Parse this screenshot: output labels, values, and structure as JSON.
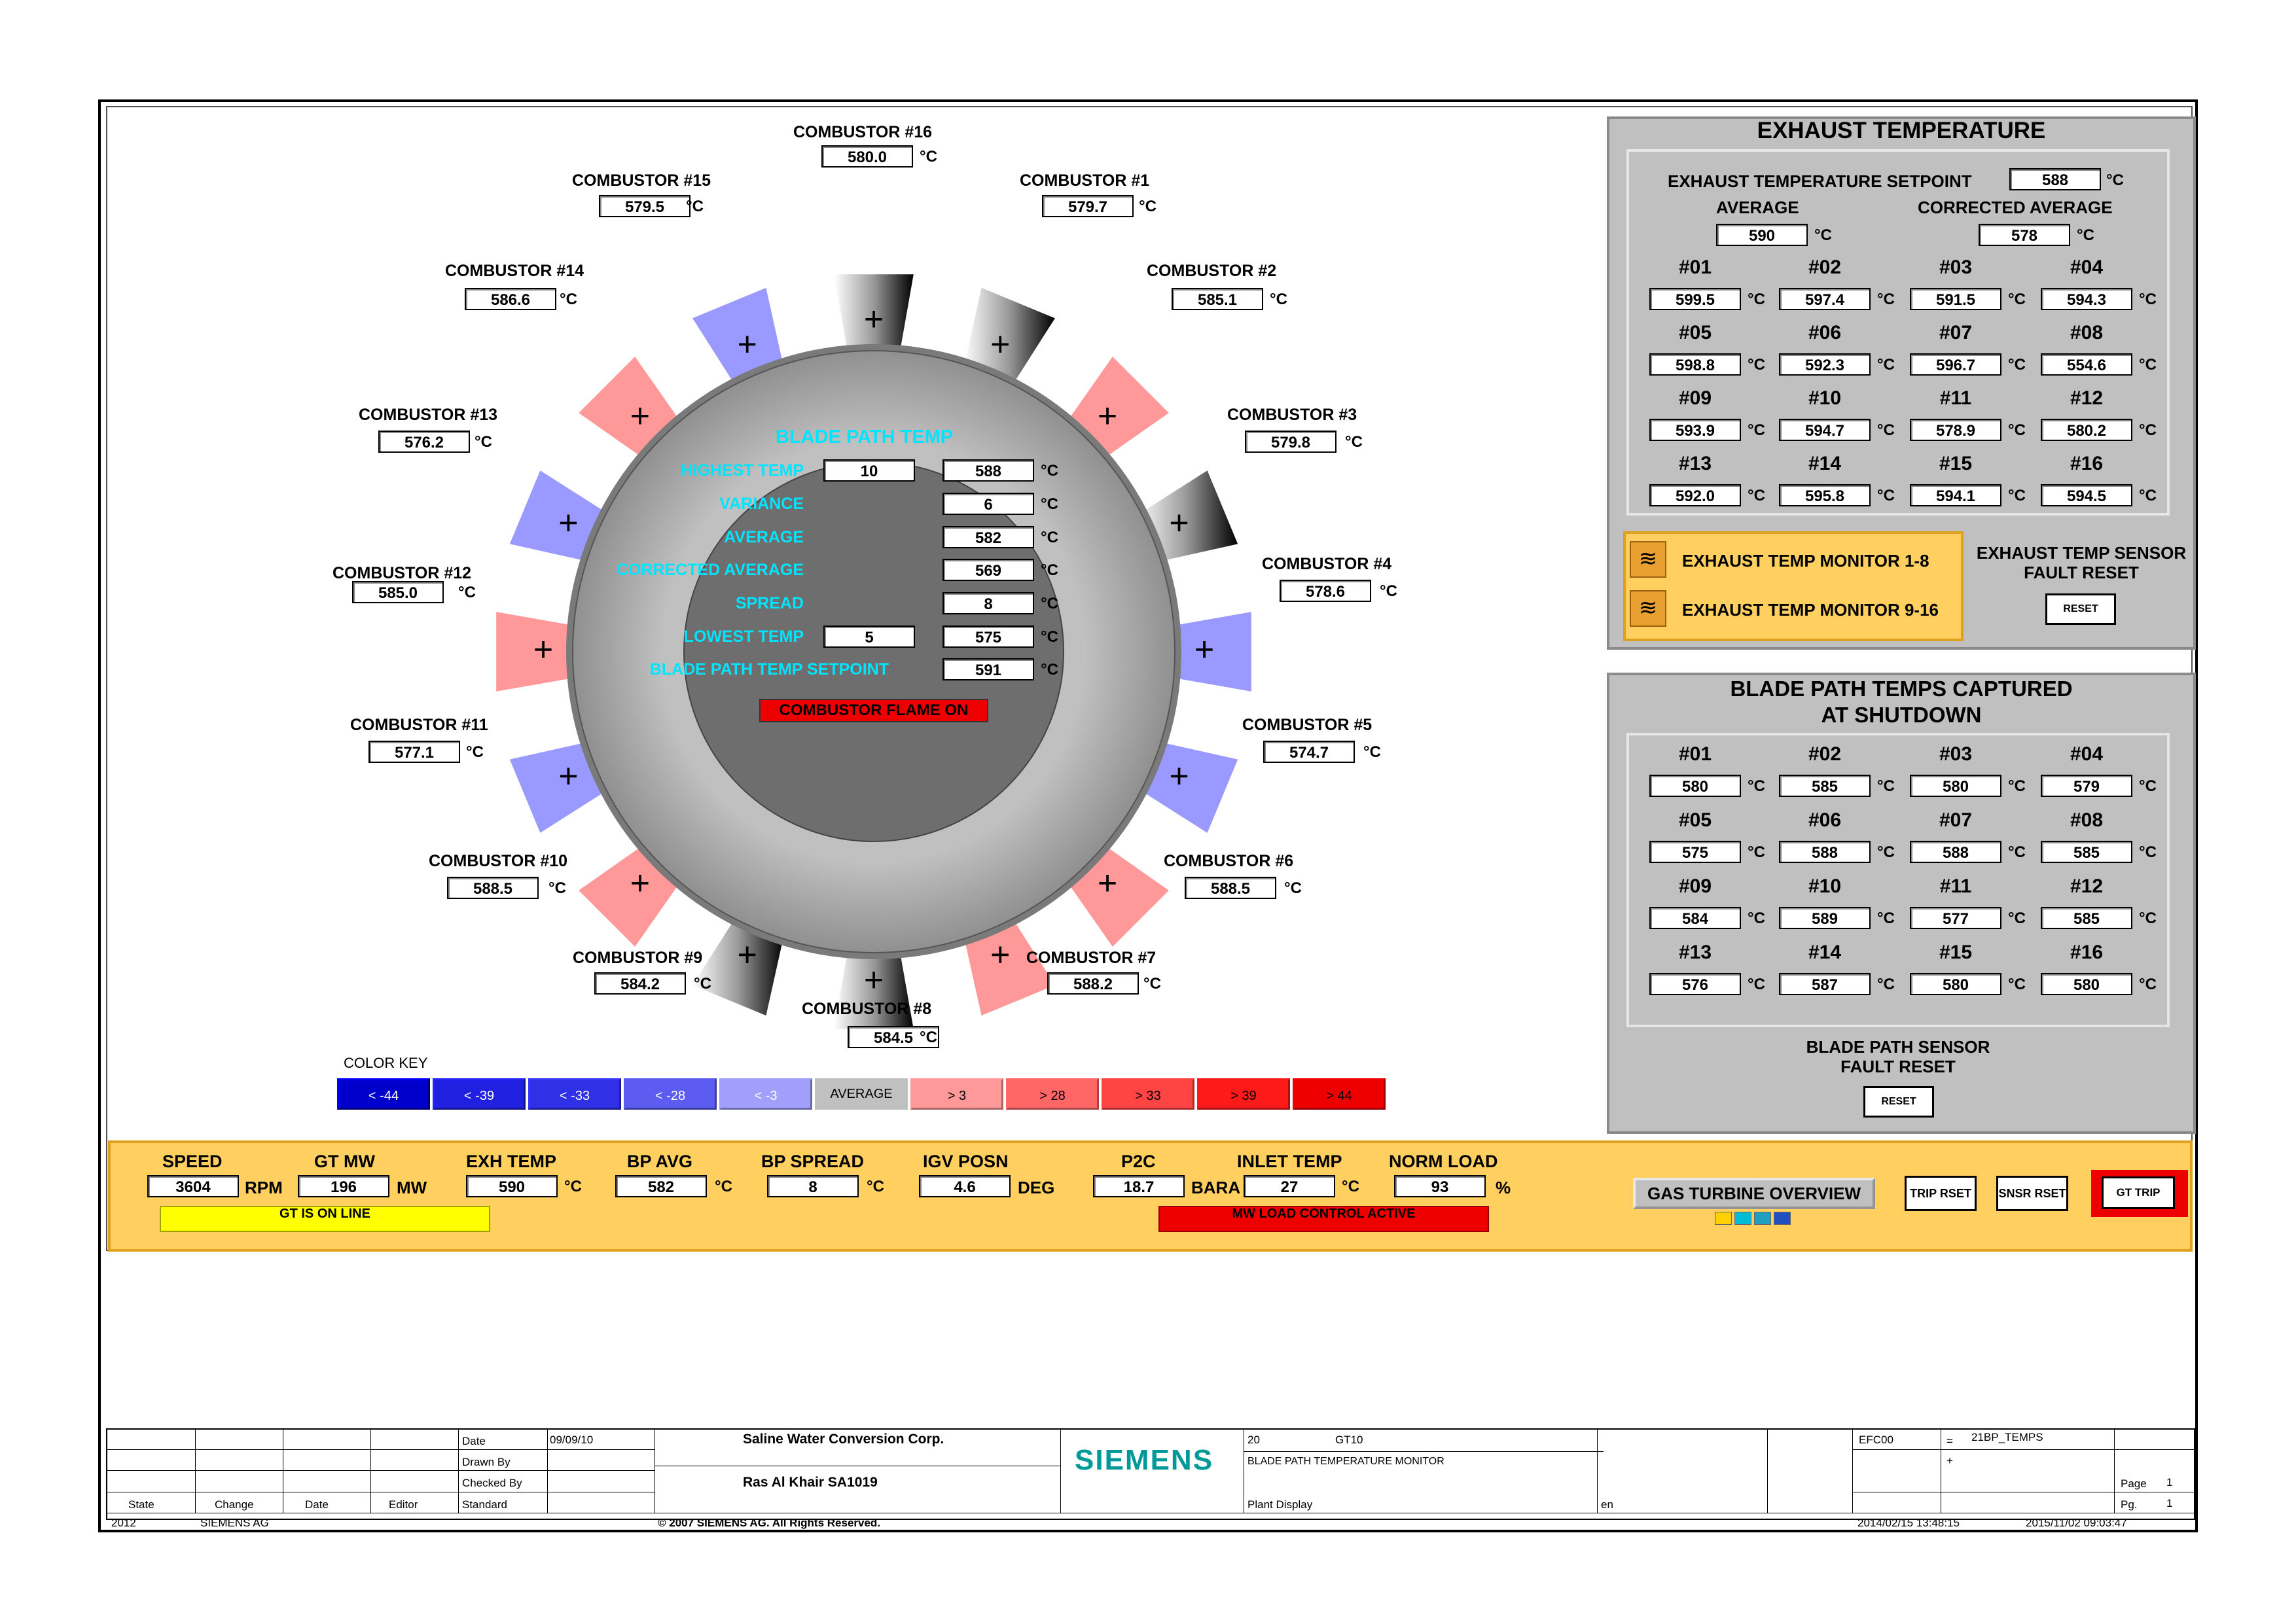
{
  "combustors": [
    {
      "id": "#16",
      "label": "COMBUSTOR #16",
      "value": "580.0"
    },
    {
      "id": "#1",
      "label": "COMBUSTOR #1",
      "value": "579.7"
    },
    {
      "id": "#2",
      "label": "COMBUSTOR #2",
      "value": "585.1"
    },
    {
      "id": "#3",
      "label": "COMBUSTOR #3",
      "value": "579.8"
    },
    {
      "id": "#4",
      "label": "COMBUSTOR #4",
      "value": "578.6"
    },
    {
      "id": "#5",
      "label": "COMBUSTOR #5",
      "value": "574.7"
    },
    {
      "id": "#6",
      "label": "COMBUSTOR #6",
      "value": "588.5"
    },
    {
      "id": "#7",
      "label": "COMBUSTOR #7",
      "value": "588.2"
    },
    {
      "id": "#8",
      "label": "COMBUSTOR #8",
      "value": "584.5"
    },
    {
      "id": "#9",
      "label": "COMBUSTOR #9",
      "value": "584.2"
    },
    {
      "id": "#10",
      "label": "COMBUSTOR #10",
      "value": "588.5"
    },
    {
      "id": "#11",
      "label": "COMBUSTOR #11",
      "value": "577.1"
    },
    {
      "id": "#12",
      "label": "COMBUSTOR #12",
      "value": "585.0"
    },
    {
      "id": "#13",
      "label": "COMBUSTOR #13",
      "value": "576.2"
    },
    {
      "id": "#14",
      "label": "COMBUSTOR #14",
      "value": "586.6"
    },
    {
      "id": "#15",
      "label": "COMBUSTOR #15",
      "value": "579.5"
    }
  ],
  "unit_c": "°C",
  "blade_path": {
    "title": "BLADE PATH TEMP",
    "highest_label": "HIGHEST TEMP",
    "highest_idx": "10",
    "highest_val": "588",
    "variance_label": "VARIANCE",
    "variance_val": "6",
    "average_label": "AVERAGE",
    "average_val": "582",
    "corrected_label": "CORRECTED AVERAGE",
    "corrected_val": "569",
    "spread_label": "SPREAD",
    "spread_val": "8",
    "lowest_label": "LOWEST TEMP",
    "lowest_idx": "5",
    "lowest_val": "575",
    "setpoint_label": "BLADE PATH TEMP SETPOINT",
    "setpoint_val": "591",
    "flame_status": "COMBUSTOR FLAME ON"
  },
  "color_key": {
    "label": "COLOR KEY",
    "items": [
      "< -44",
      "< -39",
      "< -33",
      "< -28",
      "< -3",
      "AVERAGE",
      "> 3",
      "> 28",
      "> 33",
      "> 39",
      "> 44"
    ],
    "colors": [
      "#0000cc",
      "#2020e0",
      "#3030e6",
      "#5c5cf0",
      "#a0a0fa",
      "#c0c0c0",
      "#ff9999",
      "#ff6666",
      "#ff4444",
      "#ff1a1a",
      "#ee0000"
    ]
  },
  "exhaust": {
    "title": "EXHAUST TEMPERATURE",
    "setpoint_label": "EXHAUST TEMPERATURE SETPOINT",
    "setpoint_val": "588",
    "avg_label": "AVERAGE",
    "avg_val": "590",
    "corr_label": "CORRECTED AVERAGE",
    "corr_val": "578",
    "cells": [
      {
        "n": "#01",
        "v": "599.5"
      },
      {
        "n": "#02",
        "v": "597.4"
      },
      {
        "n": "#03",
        "v": "591.5"
      },
      {
        "n": "#04",
        "v": "594.3"
      },
      {
        "n": "#05",
        "v": "598.8"
      },
      {
        "n": "#06",
        "v": "592.3"
      },
      {
        "n": "#07",
        "v": "596.7"
      },
      {
        "n": "#08",
        "v": "554.6"
      },
      {
        "n": "#09",
        "v": "593.9"
      },
      {
        "n": "#10",
        "v": "594.7"
      },
      {
        "n": "#11",
        "v": "578.9"
      },
      {
        "n": "#12",
        "v": "580.2"
      },
      {
        "n": "#13",
        "v": "592.0"
      },
      {
        "n": "#14",
        "v": "595.8"
      },
      {
        "n": "#15",
        "v": "594.1"
      },
      {
        "n": "#16",
        "v": "594.5"
      }
    ],
    "monitor1": "EXHAUST TEMP MONITOR 1-8",
    "monitor2": "EXHAUST TEMP MONITOR 9-16",
    "fault_line1": "EXHAUST TEMP SENSOR",
    "fault_line2": "FAULT RESET",
    "reset": "RESET"
  },
  "captured": {
    "title1": "BLADE PATH TEMPS CAPTURED",
    "title2": "AT SHUTDOWN",
    "cells": [
      {
        "n": "#01",
        "v": "580"
      },
      {
        "n": "#02",
        "v": "585"
      },
      {
        "n": "#03",
        "v": "580"
      },
      {
        "n": "#04",
        "v": "579"
      },
      {
        "n": "#05",
        "v": "575"
      },
      {
        "n": "#06",
        "v": "588"
      },
      {
        "n": "#07",
        "v": "588"
      },
      {
        "n": "#08",
        "v": "585"
      },
      {
        "n": "#09",
        "v": "584"
      },
      {
        "n": "#10",
        "v": "589"
      },
      {
        "n": "#11",
        "v": "577"
      },
      {
        "n": "#12",
        "v": "585"
      },
      {
        "n": "#13",
        "v": "576"
      },
      {
        "n": "#14",
        "v": "587"
      },
      {
        "n": "#15",
        "v": "580"
      },
      {
        "n": "#16",
        "v": "580"
      }
    ],
    "fault_line1": "BLADE PATH SENSOR",
    "fault_line2": "FAULT RESET",
    "reset": "RESET"
  },
  "status": {
    "speed_label": "SPEED",
    "speed_val": "3604",
    "speed_unit": "RPM",
    "mw_label": "GT MW",
    "mw_val": "196",
    "mw_unit": "MW",
    "exh_label": "EXH TEMP",
    "exh_val": "590",
    "bpavg_label": "BP AVG",
    "bpavg_val": "582",
    "bpspread_label": "BP SPREAD",
    "bpspread_val": "8",
    "igv_label": "IGV POSN",
    "igv_val": "4.6",
    "igv_unit": "DEG",
    "p2c_label": "P2C",
    "p2c_val": "18.7",
    "p2c_unit": "BARA",
    "inlet_label": "INLET TEMP",
    "inlet_val": "27",
    "load_label": "NORM LOAD",
    "load_val": "93",
    "load_unit": "%",
    "online": "GT IS ON LINE",
    "mwload": "MW LOAD CONTROL ACTIVE",
    "overview_btn": "GAS TURBINE OVERVIEW",
    "trip_rset": "TRIP RSET",
    "snsr_rset": "SNSR RSET",
    "gt_trip": "GT TRIP"
  },
  "titleblock": {
    "date_label": "Date",
    "date_val": "09/09/10",
    "drawn_label": "Drawn By",
    "checked_label": "Checked By",
    "standard_label": "Standard",
    "state_label": "State",
    "change_label": "Change",
    "date2_label": "Date",
    "editor_label": "Editor",
    "company": "Saline Water Conversion Corp.",
    "site": "Ras Al Khair SA1019",
    "brand": "SIEMENS",
    "num20": "20",
    "gt10": "GT10",
    "display_title": "BLADE PATH TEMPERATURE MONITOR",
    "plant_display": "Plant Display",
    "lang": "en",
    "efc": "EFC00",
    "eq": "=",
    "ref": "21BP_TEMPS",
    "plus": "+",
    "page_label": "Page",
    "page_val": "1",
    "pg_label": "Pg.",
    "pg_val": "1",
    "year": "2012",
    "siemens_ag": "SIEMENS AG",
    "copyright": "© 2007 SIEMENS AG. All Rights Reserved.",
    "ts1": "2014/02/15 13:48:15",
    "ts2": "2015/11/02 09:03:47"
  }
}
